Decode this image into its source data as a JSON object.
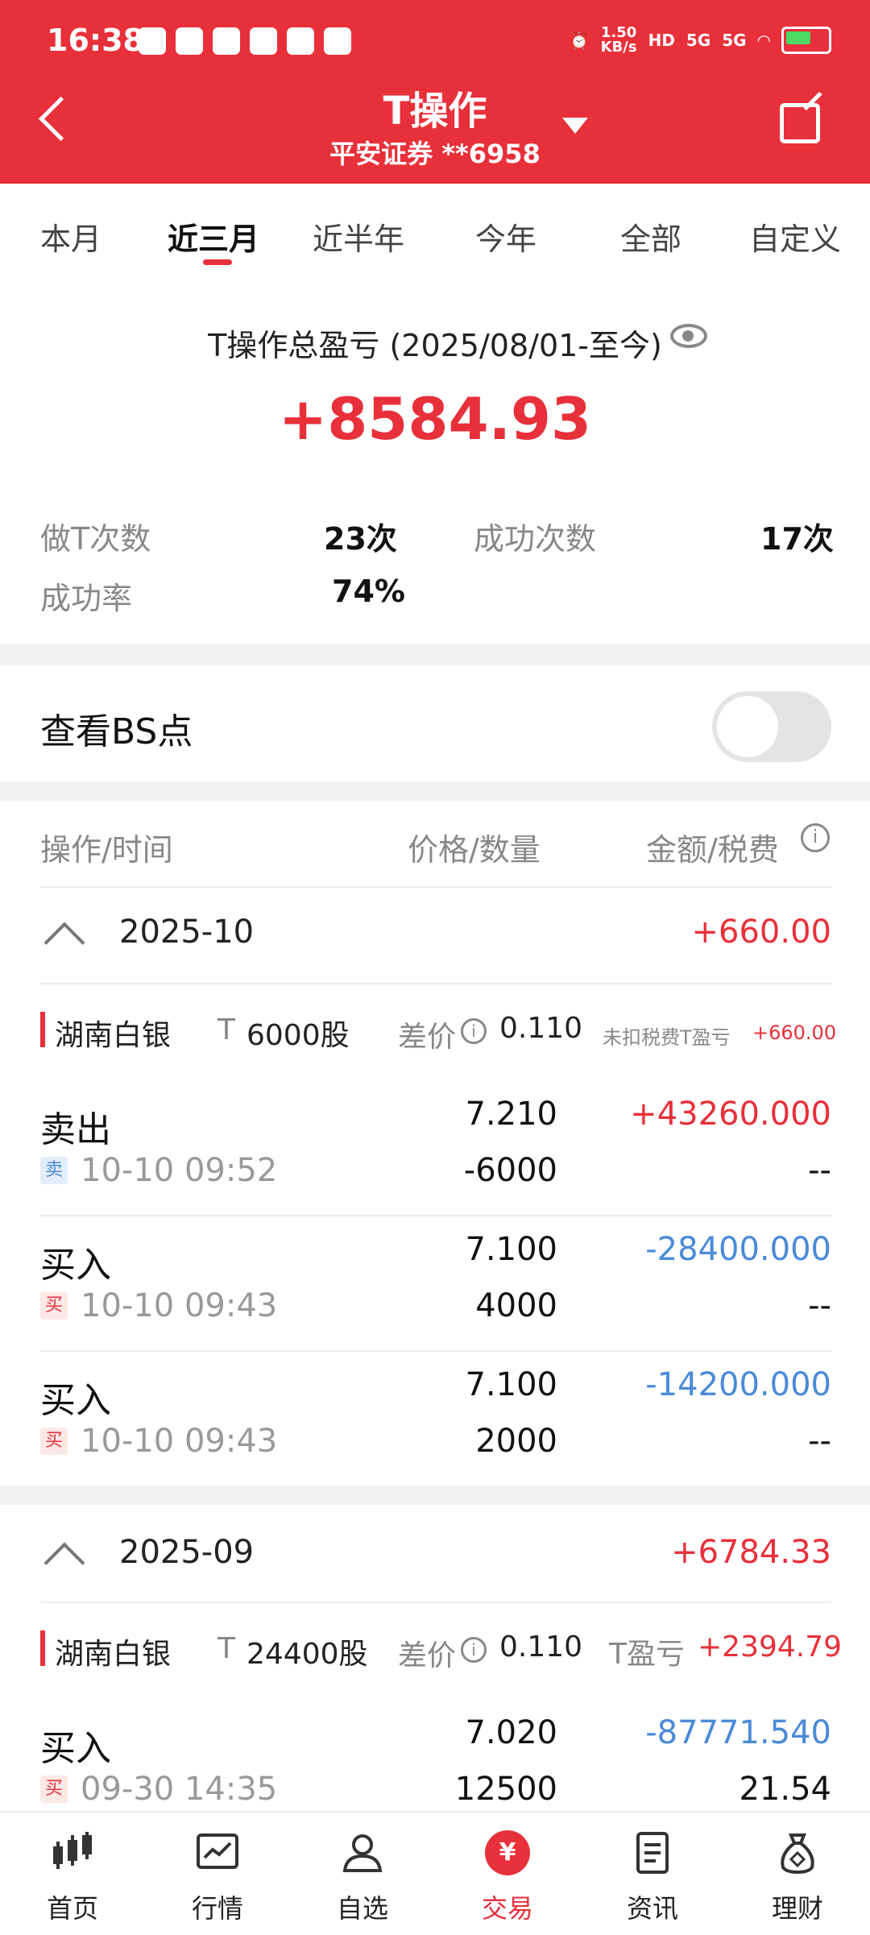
{
  "status_bar": {
    "time": "16:38",
    "net_speed_top": "1.50",
    "net_speed_bottom": "KB/s",
    "hd": "HD",
    "sig1": "5G",
    "sig2": "5G"
  },
  "header": {
    "title": "T操作",
    "subtitle": "平安证券 **6958"
  },
  "tabs": [
    {
      "label": "本月"
    },
    {
      "label": "近三月"
    },
    {
      "label": "近半年"
    },
    {
      "label": "今年"
    },
    {
      "label": "全部"
    },
    {
      "label": "自定义"
    }
  ],
  "summary": {
    "title": "T操作总盈亏 (2025/08/01-至今)",
    "total": "+8584.93",
    "stats": {
      "count_label": "做T次数",
      "count_value": "23次",
      "success_label": "成功次数",
      "success_value": "17次",
      "rate_label": "成功率",
      "rate_value": "74%"
    }
  },
  "bs_point": {
    "label": "查看BS点",
    "enabled": false
  },
  "columns": {
    "op_time": "操作/时间",
    "price_qty": "价格/数量",
    "amount_fee": "金额/税费"
  },
  "groups": [
    {
      "month": "2025-10",
      "amount": "+660.00",
      "stock": "湖南白银",
      "t_letter": "T",
      "shares": "6000股",
      "diff_label": "差价",
      "diff_value": "0.110",
      "pl_label": "未扣税费T盈亏",
      "pl_value": "+660.00",
      "trades": [
        {
          "op": "卖出",
          "badge": "卖",
          "time": "10-10 09:52",
          "price": "7.210",
          "qty": "-6000",
          "amount": "+43260.000",
          "fee": "--"
        },
        {
          "op": "买入",
          "badge": "买",
          "time": "10-10 09:43",
          "price": "7.100",
          "qty": "4000",
          "amount": "-28400.000",
          "fee": "--"
        },
        {
          "op": "买入",
          "badge": "买",
          "time": "10-10 09:43",
          "price": "7.100",
          "qty": "2000",
          "amount": "-14200.000",
          "fee": "--"
        }
      ]
    },
    {
      "month": "2025-09",
      "amount": "+6784.33",
      "stock": "湖南白银",
      "t_letter": "T",
      "shares": "24400股",
      "diff_label": "差价",
      "diff_value": "0.110",
      "pl_label": "T盈亏",
      "pl_value": "+2394.79",
      "trades": [
        {
          "op": "买入",
          "badge": "买",
          "time": "09-30 14:35",
          "price": "7.020",
          "qty": "12500",
          "amount": "-87771.540",
          "fee": "21.54"
        }
      ]
    }
  ],
  "bottom_nav": [
    {
      "label": "首页",
      "icon": "candlestick-icon"
    },
    {
      "label": "行情",
      "icon": "chart-icon"
    },
    {
      "label": "自选",
      "icon": "user-star-icon"
    },
    {
      "label": "交易",
      "icon": "yuan-icon",
      "glyph": "¥"
    },
    {
      "label": "资讯",
      "icon": "document-icon"
    },
    {
      "label": "理财",
      "icon": "money-bag-icon"
    }
  ],
  "colors": {
    "brand_red": "#e8303a",
    "buy_blue": "#4a8ad8"
  }
}
